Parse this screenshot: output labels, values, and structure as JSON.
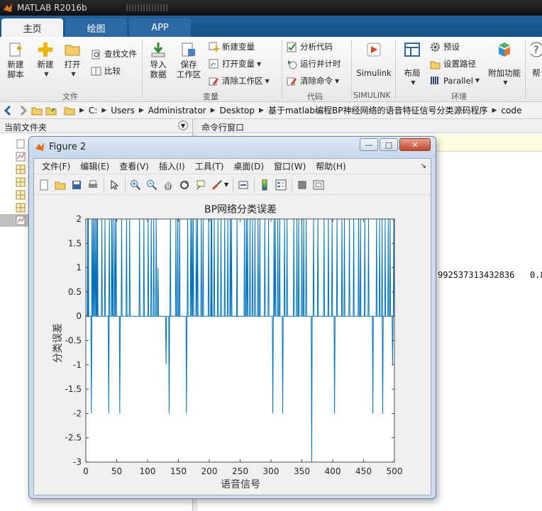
{
  "app": {
    "title": "MATLAB R2016b"
  },
  "tabs": [
    {
      "label": "主页",
      "active": true
    },
    {
      "label": "绘图"
    },
    {
      "label": "APP"
    }
  ],
  "ribbon": {
    "new_script": "新建\n脚本",
    "new": "新建",
    "open": "打开",
    "find_files": "查找文件",
    "compare": "比较",
    "import_data": "导入\n数据",
    "save_workspace": "保存\n工作区",
    "new_variable": "新建变量",
    "open_variable": "打开变量",
    "clear_workspace": "清除工作区",
    "analyze_code": "分析代码",
    "run_and_time": "运行并计时",
    "clear_commands": "清除命令",
    "simulink": "Simulink",
    "layout": "布局",
    "preferences": "预设",
    "set_path": "设置路径",
    "parallel": "Parallel",
    "addons": "附加功能",
    "help": "帮",
    "groups": {
      "file": "文件",
      "variable": "变量",
      "code": "代码",
      "simulink": "SIMULINK",
      "environment": "环境"
    }
  },
  "path": [
    "C:",
    "Users",
    "Administrator",
    "Desktop",
    "基于matlab编程BP神经网络的语音特征信号分类源码程序",
    "code"
  ],
  "current_folder_title": "当前文件夹",
  "command_window_title": "命令行窗口",
  "command_output": "992537313432836   0.8",
  "figure": {
    "title": "Figure 2",
    "menus": [
      "文件(F)",
      "编辑(E)",
      "查看(V)",
      "插入(I)",
      "工具(T)",
      "桌面(D)",
      "窗口(W)",
      "帮助(H)"
    ],
    "toolbar_icons": [
      "new-figure-icon",
      "open-file-icon",
      "save-icon",
      "print-icon",
      "pointer-icon",
      "zoom-in-icon",
      "zoom-out-icon",
      "pan-icon",
      "rotate-icon",
      "data-cursor-icon",
      "brush-icon",
      "link-icon",
      "colorbar-icon",
      "legend-icon",
      "hide-plot-tools-icon",
      "show-plot-tools-icon"
    ],
    "colors": {
      "line": "#0072bd",
      "titlebar": "#c6d6ea"
    }
  },
  "chart_data": {
    "type": "line",
    "title": "BP网络分类误差",
    "xlabel": "语音信号",
    "ylabel": "分类误差",
    "xlim": [
      0,
      500
    ],
    "ylim": [
      -3,
      2
    ],
    "xticks": [
      0,
      50,
      100,
      150,
      200,
      250,
      300,
      350,
      400,
      450,
      500
    ],
    "yticks": [
      -3,
      -2.5,
      -2,
      -1.5,
      -1,
      -0.5,
      0,
      0.5,
      1,
      1.5,
      2
    ],
    "ytick_labels": [
      "-3",
      "-2.5",
      "-2",
      "-1.5",
      "-1",
      "-0.5",
      "0",
      "0.5",
      "1",
      "1.5",
      "2"
    ],
    "series": [
      {
        "spikes": [
          [
            3,
            2
          ],
          [
            4,
            2
          ],
          [
            9,
            -2
          ],
          [
            10,
            2
          ],
          [
            12,
            2
          ],
          [
            14,
            2
          ],
          [
            16,
            2
          ],
          [
            18,
            2
          ],
          [
            19,
            2
          ],
          [
            26,
            2
          ],
          [
            31,
            2
          ],
          [
            37,
            -2
          ],
          [
            38,
            2
          ],
          [
            42,
            2
          ],
          [
            44,
            2
          ],
          [
            47,
            2
          ],
          [
            49,
            2
          ],
          [
            55,
            -2
          ],
          [
            58,
            2
          ],
          [
            66,
            2
          ],
          [
            71,
            2
          ],
          [
            87,
            2
          ],
          [
            94,
            2
          ],
          [
            101,
            2
          ],
          [
            106,
            2
          ],
          [
            110,
            2
          ],
          [
            114,
            2
          ],
          [
            117,
            1
          ],
          [
            130,
            -1
          ],
          [
            135,
            -2
          ],
          [
            137,
            2
          ],
          [
            146,
            2
          ],
          [
            149,
            2
          ],
          [
            152,
            2
          ],
          [
            163,
            -2
          ],
          [
            165,
            2
          ],
          [
            170,
            2
          ],
          [
            172,
            2
          ],
          [
            174,
            2
          ],
          [
            179,
            2
          ],
          [
            181,
            2
          ],
          [
            187,
            2
          ],
          [
            190,
            2
          ],
          [
            199,
            2
          ],
          [
            203,
            2
          ],
          [
            204,
            2
          ],
          [
            208,
            2
          ],
          [
            214,
            2
          ],
          [
            219,
            2
          ],
          [
            225,
            2
          ],
          [
            230,
            2
          ],
          [
            234,
            2
          ],
          [
            236,
            2
          ],
          [
            245,
            2
          ],
          [
            257,
            2
          ],
          [
            260,
            2
          ],
          [
            262,
            2
          ],
          [
            266,
            2
          ],
          [
            270,
            2
          ],
          [
            274,
            2
          ],
          [
            279,
            2
          ],
          [
            282,
            2
          ],
          [
            290,
            2
          ],
          [
            296,
            2
          ],
          [
            303,
            -2
          ],
          [
            305,
            2
          ],
          [
            307,
            2
          ],
          [
            311,
            2
          ],
          [
            314,
            2
          ],
          [
            319,
            -2
          ],
          [
            322,
            2
          ],
          [
            326,
            2
          ],
          [
            337,
            2
          ],
          [
            342,
            2
          ],
          [
            345,
            2
          ],
          [
            350,
            2
          ],
          [
            353,
            2
          ],
          [
            357,
            2
          ],
          [
            366,
            -3
          ],
          [
            369,
            2
          ],
          [
            376,
            2
          ],
          [
            386,
            2
          ],
          [
            393,
            2
          ],
          [
            399,
            2
          ],
          [
            403,
            -2
          ],
          [
            407,
            2
          ],
          [
            415,
            2
          ],
          [
            419,
            2
          ],
          [
            427,
            2
          ],
          [
            434,
            2
          ],
          [
            442,
            2
          ],
          [
            445,
            2
          ],
          [
            452,
            2
          ],
          [
            458,
            2
          ],
          [
            465,
            -2
          ],
          [
            471,
            2
          ],
          [
            476,
            2
          ],
          [
            480,
            2
          ],
          [
            481,
            -2
          ],
          [
            485,
            2
          ],
          [
            490,
            2
          ],
          [
            493,
            2
          ],
          [
            497,
            -1
          ],
          [
            499,
            2
          ]
        ]
      }
    ]
  }
}
